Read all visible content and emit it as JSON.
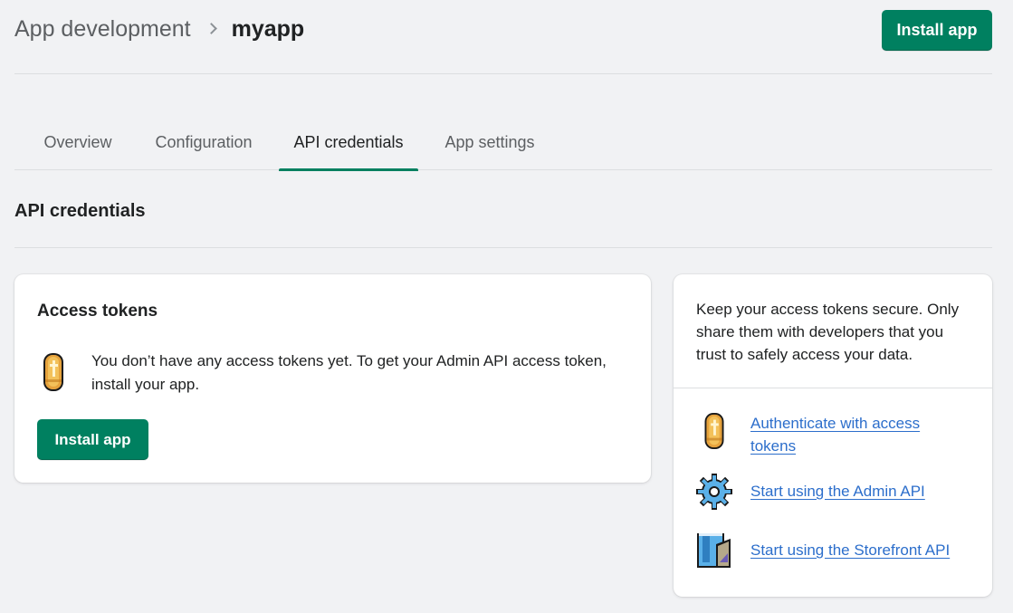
{
  "header": {
    "breadcrumb_parent": "App development",
    "breadcrumb_current": "myapp",
    "install_button": "Install app"
  },
  "tabs": [
    {
      "label": "Overview",
      "active": false
    },
    {
      "label": "Configuration",
      "active": false
    },
    {
      "label": "API credentials",
      "active": true
    },
    {
      "label": "App settings",
      "active": false
    }
  ],
  "section": {
    "title": "API credentials"
  },
  "access_tokens": {
    "title": "Access tokens",
    "icon": "coin-icon",
    "empty_message": "You don’t have any access tokens yet. To get your Admin API access token, install your app.",
    "install_button": "Install app"
  },
  "sidebar": {
    "intro": "Keep your access tokens secure. Only share them with developers that you trust to safely access your data.",
    "links": [
      {
        "label": "Authenticate with access tokens",
        "icon": "coin-icon"
      },
      {
        "label": "Start using the Admin API",
        "icon": "gear-icon"
      },
      {
        "label": "Start using the Storefront API",
        "icon": "storefront-icon"
      }
    ]
  },
  "colors": {
    "primary": "#008060",
    "link": "#2c6ecb",
    "background": "#f1f2f4"
  }
}
